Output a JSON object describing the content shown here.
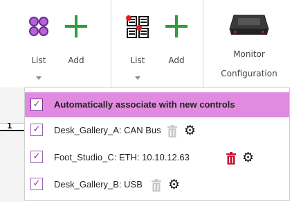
{
  "ribbon": {
    "group1": {
      "list_label": "List",
      "add_label": "Add"
    },
    "group2": {
      "list_label": "List",
      "add_label": "Add"
    },
    "monitor": {
      "line1": "Monitor",
      "line2": "Configuration"
    }
  },
  "row_marker": "1",
  "dropdown": {
    "items": [
      {
        "label": "Automatically associate with new controls",
        "checked": true
      },
      {
        "label": "Desk_Gallery_A: CAN Bus",
        "checked": true,
        "trash_state": "disabled"
      },
      {
        "label": "Foot_Studio_C: ETH: 10.10.12.63",
        "checked": true,
        "trash_state": "enabled"
      },
      {
        "label": "Desk_Gallery_B: USB",
        "checked": true,
        "trash_state": "disabled"
      }
    ],
    "check_glyph": "✓",
    "gear_glyph": "⚙"
  },
  "colors": {
    "highlight": "#e08be0",
    "add_green": "#2e9e3a",
    "trash_enabled": "#c8102e",
    "trash_disabled": "#c8c8c8",
    "list_icon_purple": "#9b4fc0"
  }
}
